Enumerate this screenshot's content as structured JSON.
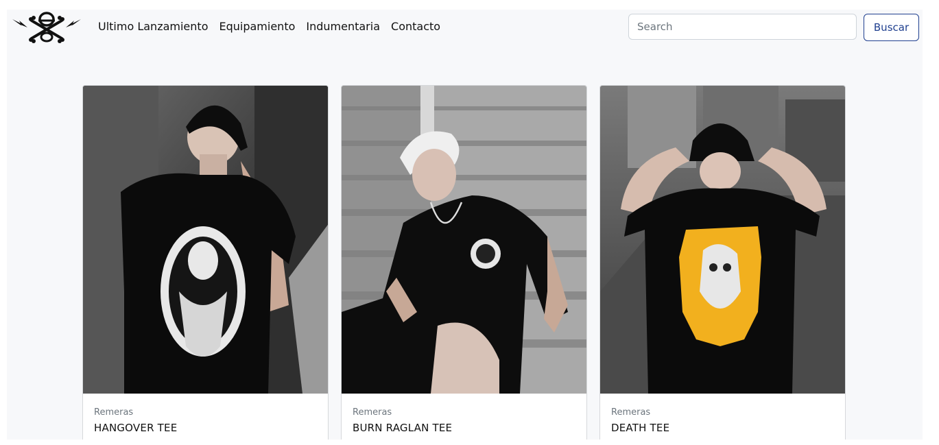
{
  "navbar": {
    "links": [
      "Ultimo Lanzamiento",
      "Equipamiento",
      "Indumentaria",
      "Contacto"
    ],
    "search_placeholder": "Search",
    "search_button_label": "Buscar"
  },
  "colors": {
    "accent": "#1f3f8f",
    "background": "#f7f8fa",
    "print_yellow": "#f2b01e"
  },
  "products": [
    {
      "category": "Remeras",
      "title": "HANGOVER TEE"
    },
    {
      "category": "Remeras",
      "title": "BURN RAGLAN TEE"
    },
    {
      "category": "Remeras",
      "title": "DEATH TEE"
    }
  ]
}
